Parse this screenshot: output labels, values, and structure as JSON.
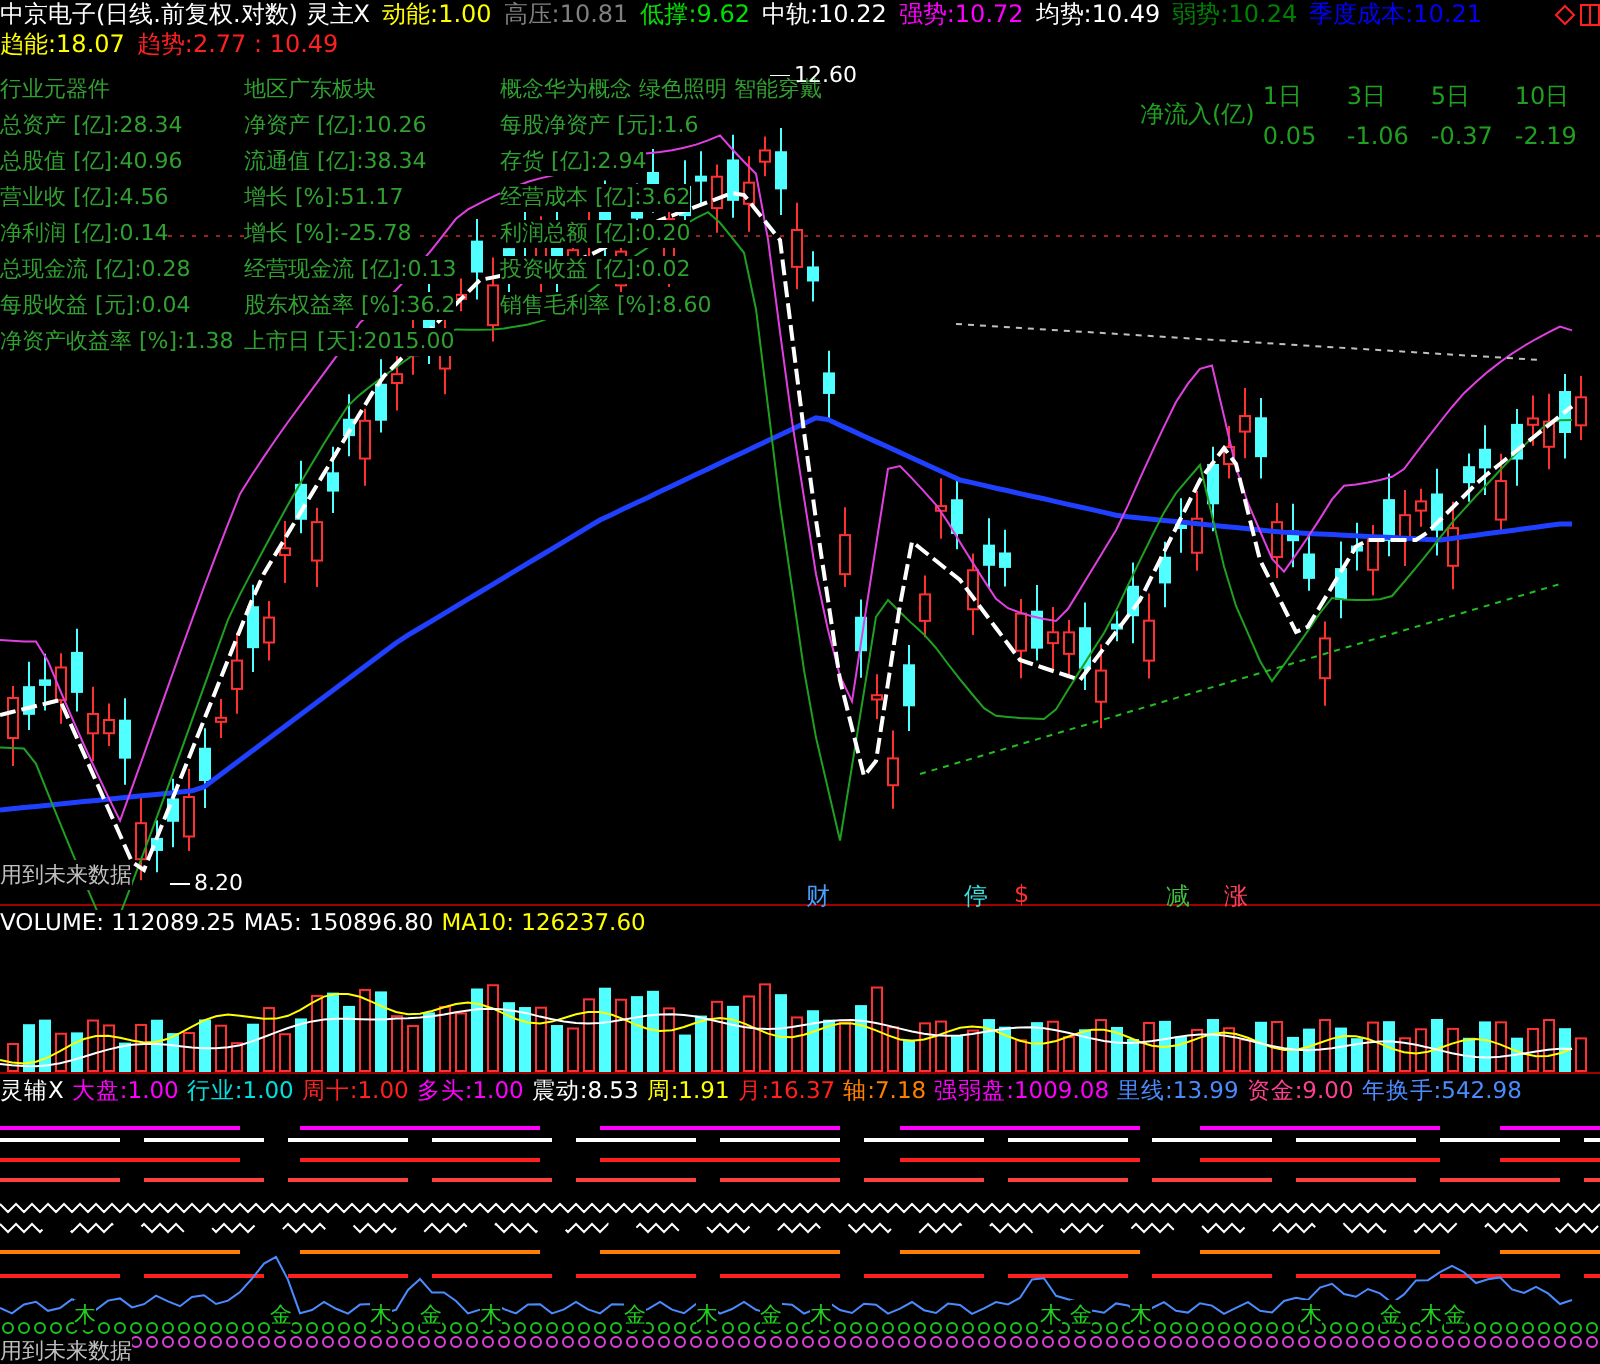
{
  "header": {
    "line_1": [
      {
        "text": "中京电子(日线.前复权.对数) 灵主X",
        "color": "#ffffff"
      },
      {
        "text": "动能:",
        "value": "1.00",
        "color": "#ffff00"
      },
      {
        "text": "高压:",
        "value": "10.81",
        "color": "#808080"
      },
      {
        "text": "低撑:",
        "value": "9.62",
        "color": "#00e000"
      },
      {
        "text": "中轨:",
        "value": "10.22",
        "color": "#ffffff"
      },
      {
        "text": "强势:",
        "value": "10.72",
        "color": "#ff00ff"
      },
      {
        "text": "均势:",
        "value": "10.49",
        "color": "#ffffff"
      },
      {
        "text": "弱势:",
        "value": "10.24",
        "color": "#008000"
      },
      {
        "text": "季度成本:",
        "value": "10.21",
        "color": "#0000ff"
      }
    ],
    "line_2": [
      {
        "text": "趋能:",
        "value": "18.07",
        "color": "#ffff00"
      },
      {
        "text": "趋势:",
        "value": "2.77 : 10.49",
        "color": "#ff2020"
      }
    ]
  },
  "info_rows": [
    [
      "行业元器件",
      "地区广东板块",
      "概念华为概念 绿色照明 智能穿戴"
    ],
    [
      "总资产 [亿]:28.34",
      "净资产 [亿]:10.26",
      "每股净资产 [元]:1.6"
    ],
    [
      "总股值 [亿]:40.96",
      "流通值 [亿]:38.34",
      "存货 [亿]:2.94"
    ],
    [
      "营业收 [亿]:4.56",
      "增长 [%]:51.17",
      "经营成本 [亿]:3.62"
    ],
    [
      "净利润 [亿]:0.14",
      "增长 [%]:-25.78",
      "利润总额 [亿]:0.20"
    ],
    [
      "总现金流 [亿]:0.28",
      "经营现金流 [亿]:0.13",
      "投资收益 [亿]:0.02"
    ],
    [
      "每股收益 [元]:0.04",
      "股东权益率 [%]:36.2",
      "销售毛利率 [%]:8.60"
    ],
    [
      "净资产收益率 [%]:1.38",
      "上市日 [天]:2015.00"
    ]
  ],
  "net_inflow": {
    "label": "净流入(亿)",
    "columns": [
      "1日",
      "3日",
      "5日",
      "10日"
    ],
    "values": [
      "0.05",
      "-1.06",
      "-0.37",
      "-2.19"
    ]
  },
  "chart_labels": {
    "high": "12.60",
    "low": "8.20",
    "future_note": "用到未来数据"
  },
  "event_markers": [
    {
      "text": "财",
      "color": "#4aa0ff"
    },
    {
      "text": "停",
      "color": "#40e0e0"
    },
    {
      "text": "$",
      "color": "#ff3030"
    },
    {
      "text": "减",
      "color": "#40c040"
    },
    {
      "text": "涨",
      "color": "#ff4060"
    }
  ],
  "volume": {
    "items": [
      {
        "text": "VOLUME:",
        "value": "112089.25",
        "color": "#ffffff"
      },
      {
        "text": "MA5:",
        "value": "150896.80",
        "color": "#ffffff"
      },
      {
        "text": "MA10:",
        "value": "126237.60",
        "color": "#ffff00"
      }
    ]
  },
  "indicator": {
    "items": [
      {
        "text": "灵辅X",
        "color": "#ffffff"
      },
      {
        "text": "大盘:",
        "value": "1.00",
        "color": "#ff00ff"
      },
      {
        "text": "行业:",
        "value": "1.00",
        "color": "#00e0e0"
      },
      {
        "text": "周十:",
        "value": "1.00",
        "color": "#ff2020"
      },
      {
        "text": "多头:",
        "value": "1.00",
        "color": "#ff00ff"
      },
      {
        "text": "震动:",
        "value": "8.53",
        "color": "#ffffff"
      },
      {
        "text": "周:",
        "value": "1.91",
        "color": "#ffff00"
      },
      {
        "text": "月:",
        "value": "16.37",
        "color": "#ff2020"
      },
      {
        "text": "轴:",
        "value": "7.18",
        "color": "#ff8000"
      },
      {
        "text": "强弱盘:",
        "value": "1009.08",
        "color": "#ff00ff"
      },
      {
        "text": "里线:",
        "value": "13.99",
        "color": "#4a8cff"
      },
      {
        "text": "资金:",
        "value": "9.00",
        "color": "#ff4090"
      },
      {
        "text": "年换手:",
        "value": "542.98",
        "color": "#4a8cff"
      }
    ],
    "signals": [
      "木",
      "金",
      "木",
      "金",
      "木",
      "金",
      "木",
      "金",
      "木",
      "木",
      "金",
      "木",
      "木",
      "金",
      "木",
      "金"
    ],
    "future_note": "用到未来数据"
  }
}
